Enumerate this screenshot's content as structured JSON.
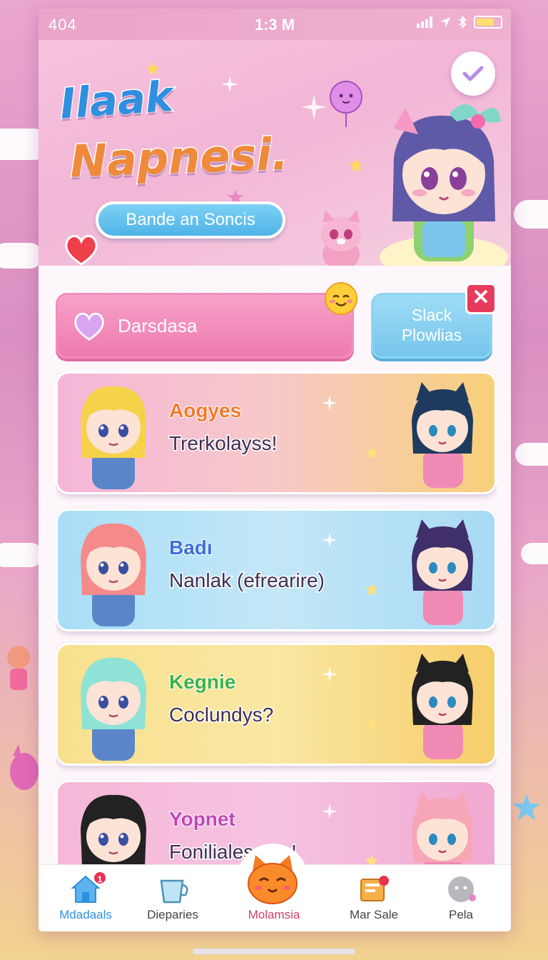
{
  "status_bar": {
    "carrier": "404",
    "time": "1:3 M"
  },
  "hero": {
    "title_line1": "Ilaak",
    "title_line2": "Napnesi.",
    "button_label": "Bande an Soncis"
  },
  "actions": {
    "primary_label": "Darsdasa",
    "secondary_label_line1": "Slack",
    "secondary_label_line2": "Plowlias"
  },
  "cards": [
    {
      "name": "Aogyes",
      "message": "Trerkolayss!",
      "name_color": "#f07a2a",
      "bg": "linear-gradient(90deg,#f5b6d8,#f7c9c8 50%,#f7d079)"
    },
    {
      "name": "Badı",
      "message": "Nanlak (efrearire)",
      "name_color": "#3d6fd9",
      "bg": "linear-gradient(90deg,#a9def6,#c3e7f7 50%,#a8daf4)"
    },
    {
      "name": "Kegnie",
      "message": "Coclundys?",
      "name_color": "#3bb24a",
      "bg": "linear-gradient(90deg,#f8e08f,#f9e7a2 50%,#f7cd6a)"
    },
    {
      "name": "Yopnet",
      "message": "Fonilialescars!",
      "name_color": "#c045b8",
      "bg": "linear-gradient(90deg,#f6b7d7,#f5c3e0 50%,#f1a9d2)"
    }
  ],
  "tabs": [
    {
      "label": "Mdadaals",
      "badge": "1"
    },
    {
      "label": "Dieparies"
    },
    {
      "label": "Molamsia"
    },
    {
      "label": "Mar Sale"
    },
    {
      "label": "Pela"
    }
  ],
  "colors": {
    "accent_blue": "#2f8fe0",
    "accent_pink": "#ee7bb0",
    "close_red": "#e83a5c"
  }
}
